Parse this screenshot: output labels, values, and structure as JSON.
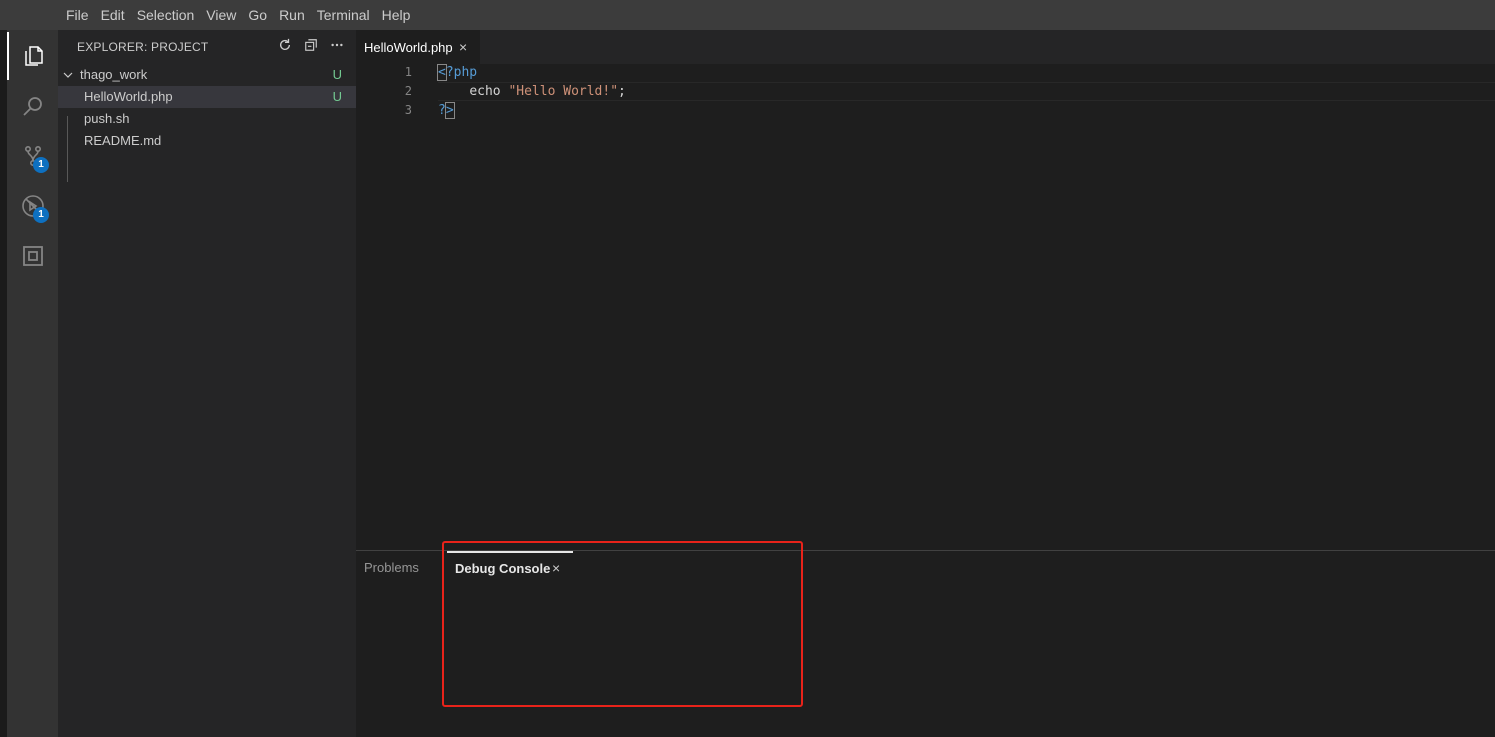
{
  "menu": [
    "File",
    "Edit",
    "Selection",
    "View",
    "Go",
    "Run",
    "Terminal",
    "Help"
  ],
  "activity": {
    "icons": [
      "files-icon",
      "search-icon",
      "source-control-icon",
      "run-debug-icon",
      "extensions-icon"
    ],
    "source_control_badge": "1",
    "debug_badge": "1"
  },
  "explorer": {
    "title": "EXPLORER: PROJECT",
    "folder": {
      "name": "thago_work",
      "status": "U"
    },
    "files": [
      {
        "name": "HelloWorld.php",
        "status": "U"
      },
      {
        "name": "push.sh",
        "status": ""
      },
      {
        "name": "README.md",
        "status": ""
      }
    ]
  },
  "editor": {
    "tab": {
      "label": "HelloWorld.php",
      "close": "×"
    },
    "line_numbers": [
      "1",
      "2",
      "3"
    ],
    "code": {
      "l1_open": "<",
      "l1_rest": "?php",
      "l2_indent": "    ",
      "l2_keyword": "echo",
      "l2_string": "\"Hello World!\"",
      "l2_semi": ";",
      "l3_q": "?",
      "l3_close": ">"
    }
  },
  "panel": {
    "tabs": [
      "Problems",
      "Debug Console"
    ],
    "active_close": "×"
  },
  "colors": {
    "accent_badge": "#0e70c0",
    "git_untracked": "#73c991",
    "highlight_box": "#e8231a"
  }
}
